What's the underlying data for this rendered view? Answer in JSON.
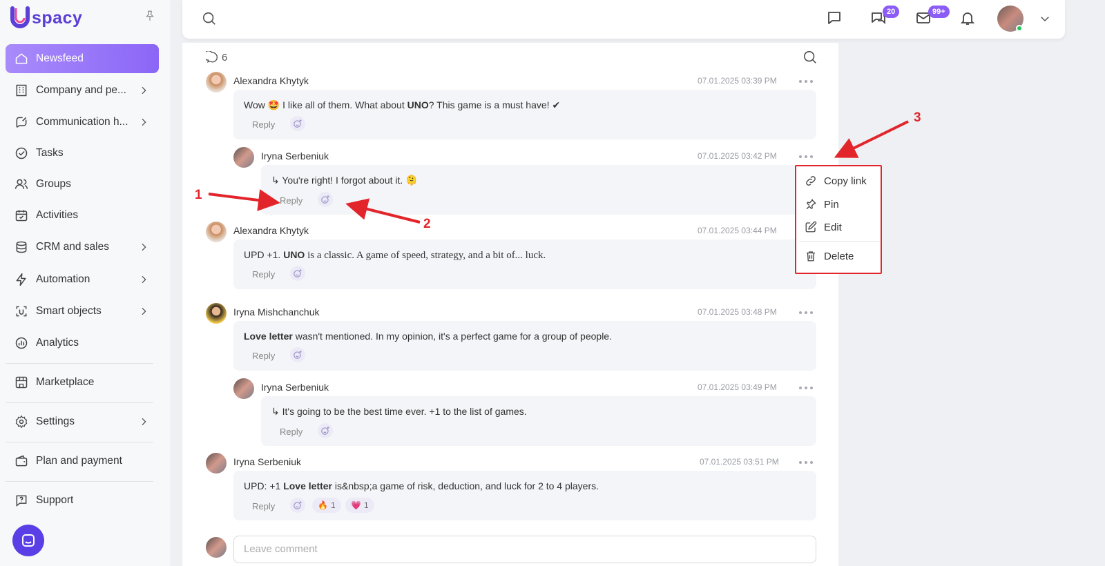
{
  "app": {
    "logo_text": "spacy"
  },
  "sidebar": {
    "items": [
      {
        "label": "Newsfeed",
        "icon": "home-icon",
        "active": true
      },
      {
        "label": "Company and pe...",
        "icon": "building-icon",
        "chevron": true
      },
      {
        "label": "Communication h...",
        "icon": "chat-edit-icon",
        "chevron": true
      },
      {
        "label": "Tasks",
        "icon": "check-circle-icon"
      },
      {
        "label": "Groups",
        "icon": "users-icon"
      },
      {
        "label": "Activities",
        "icon": "calendar-icon"
      },
      {
        "label": "CRM and sales",
        "icon": "coins-icon",
        "chevron": true
      },
      {
        "label": "Automation",
        "icon": "lightning-icon",
        "chevron": true
      },
      {
        "label": "Smart objects",
        "icon": "scan-icon",
        "chevron": true
      },
      {
        "label": "Analytics",
        "icon": "chart-icon"
      },
      {
        "label": "Marketplace",
        "icon": "store-icon"
      },
      {
        "label": "Settings",
        "icon": "gear-icon",
        "chevron": true
      },
      {
        "label": "Plan and payment",
        "icon": "wallet-icon"
      },
      {
        "label": "Support",
        "icon": "question-icon"
      }
    ]
  },
  "header": {
    "badges": {
      "chats": "20",
      "mail": "99+"
    }
  },
  "feed": {
    "comment_count": "6",
    "comments": [
      {
        "author": "Alexandra Khytyk",
        "time": "07.01.2025 03:39 PM",
        "reply": "Reply"
      },
      {
        "author": "Iryna Serbeniuk",
        "time": "07.01.2025 03:42 PM",
        "reply": "Reply"
      },
      {
        "author": "Alexandra Khytyk",
        "time": "07.01.2025 03:44 PM",
        "reply": "Reply"
      },
      {
        "author": "Iryna Mishchanchuk",
        "time": "07.01.2025 03:48 PM",
        "reply": "Reply"
      },
      {
        "author": "Iryna Serbeniuk",
        "time": "07.01.2025 03:49 PM",
        "reply": "Reply"
      },
      {
        "author": "Iryna Serbeniuk",
        "time": "07.01.2025 03:51 PM",
        "reply": "Reply"
      }
    ],
    "text_parts": {
      "c0a": "Wow 🤩 I like all of them. What about ",
      "c0b": "UNO",
      "c0c": "? This game is a must have! ✔",
      "c1": "↳ You're right! I forgot about it. 🫠",
      "c2a": "UPD +1. ",
      "c2b": "UNO",
      "c2c": " is a classic. A game of speed, strategy, and a bit of... luck.",
      "c3a": "Love letter",
      "c3b": " wasn't mentioned. In my opinion, it's a perfect game for a group of people.",
      "c4": "↳ It's going to be the best time ever. +1 to the list of games.",
      "c5a": "UPD: +1 ",
      "c5b": "Love letter",
      "c5c": " is&nbsp;a game of risk, deduction, and luck for 2 to 4 players."
    },
    "reactions": [
      {
        "emoji": "🔥",
        "count": "1"
      },
      {
        "emoji": "💗",
        "count": "1"
      }
    ],
    "input_placeholder": "Leave comment"
  },
  "menu": {
    "items": [
      {
        "label": "Copy link",
        "icon": "link-icon"
      },
      {
        "label": "Pin",
        "icon": "pin-icon"
      },
      {
        "label": "Edit",
        "icon": "edit-icon"
      },
      {
        "label": "Delete",
        "icon": "trash-icon"
      }
    ]
  },
  "annotations": {
    "one": "1",
    "two": "2",
    "three": "3"
  },
  "colors": {
    "accent": "#8b5cf6",
    "annotation": "#e2252b",
    "online": "#22c55e"
  }
}
